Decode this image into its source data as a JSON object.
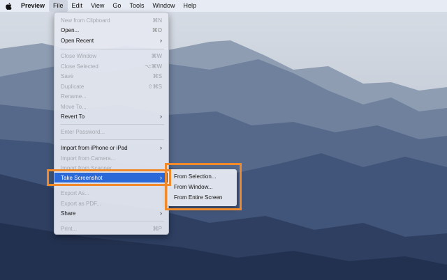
{
  "menubar": {
    "apple_icon": "apple-logo-icon",
    "items": [
      "Preview",
      "File",
      "Edit",
      "View",
      "Go",
      "Tools",
      "Window",
      "Help"
    ]
  },
  "file_menu": {
    "items": [
      {
        "label": "New from Clipboard",
        "shortcut": "⌘N",
        "enabled": false
      },
      {
        "label": "Open...",
        "shortcut": "⌘O",
        "enabled": true
      },
      {
        "label": "Open Recent",
        "submenu": true,
        "enabled": true
      },
      {
        "label": "Close Window",
        "shortcut": "⌘W",
        "enabled": false
      },
      {
        "label": "Close Selected",
        "shortcut": "⌥⌘W",
        "enabled": false
      },
      {
        "label": "Save",
        "shortcut": "⌘S",
        "enabled": false
      },
      {
        "label": "Duplicate",
        "shortcut": "⇧⌘S",
        "enabled": false
      },
      {
        "label": "Rename...",
        "enabled": false
      },
      {
        "label": "Move To...",
        "enabled": false
      },
      {
        "label": "Revert To",
        "submenu": true,
        "enabled": true
      },
      {
        "label": "Enter Password...",
        "enabled": false
      },
      {
        "label": "Import from iPhone or iPad",
        "submenu": true,
        "enabled": true
      },
      {
        "label": "Import from Camera...",
        "enabled": false
      },
      {
        "label": "Import from Scanner...",
        "enabled": false
      },
      {
        "label": "Take Screenshot",
        "submenu": true,
        "enabled": true,
        "selected": true
      },
      {
        "label": "Export As...",
        "enabled": false
      },
      {
        "label": "Export as PDF...",
        "enabled": false
      },
      {
        "label": "Share",
        "submenu": true,
        "enabled": true
      },
      {
        "label": "Print...",
        "shortcut": "⌘P",
        "enabled": false
      }
    ]
  },
  "screenshot_submenu": {
    "items": [
      "From Selection...",
      "From Window...",
      "From Entire Screen"
    ]
  },
  "colors": {
    "highlight_box": "#f08a2b",
    "selection": "#2b69d9"
  }
}
